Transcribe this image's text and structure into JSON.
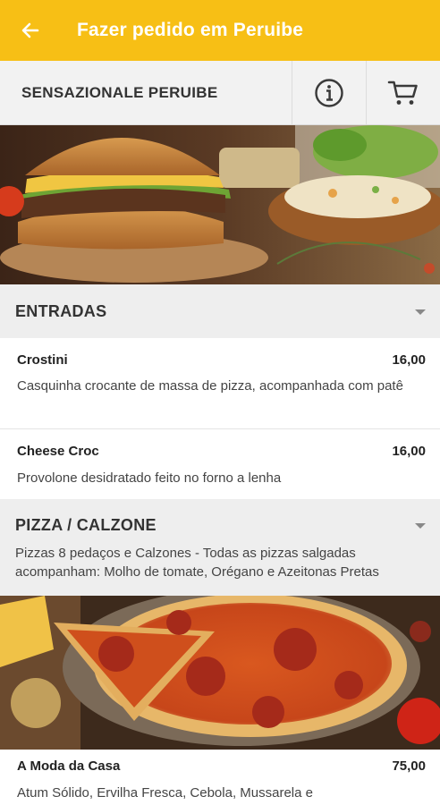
{
  "appbar": {
    "title": "Fazer pedido em Peruibe",
    "back_icon": "arrow-left-icon"
  },
  "store": {
    "name": "SENSAZIONALE PERUIBE",
    "info_icon": "info-icon",
    "cart_icon": "cart-icon"
  },
  "sections": [
    {
      "title": "ENTRADAS",
      "items": [
        {
          "name": "Crostini",
          "price": "16,00",
          "desc": "Casquinha crocante de massa de pizza, acompanhada com patê"
        },
        {
          "name": "Cheese Croc",
          "price": "16,00",
          "desc": "Provolone desidratado feito no forno a lenha"
        }
      ]
    },
    {
      "title": "PIZZA / CALZONE",
      "desc": "Pizzas 8 pedaços e Calzones - Todas as pizzas salgadas acompanham: Molho de tomate, Orégano e Azeitonas Pretas",
      "items": [
        {
          "name": "A Moda da Casa",
          "price": "75,00",
          "desc": "Atum Sólido, Ervilha Fresca, Cebola, Mussarela e"
        }
      ]
    }
  ],
  "colors": {
    "accent": "#f7bf15",
    "section_bg": "#eeeeee",
    "store_bar_bg": "#f2f2f2"
  }
}
